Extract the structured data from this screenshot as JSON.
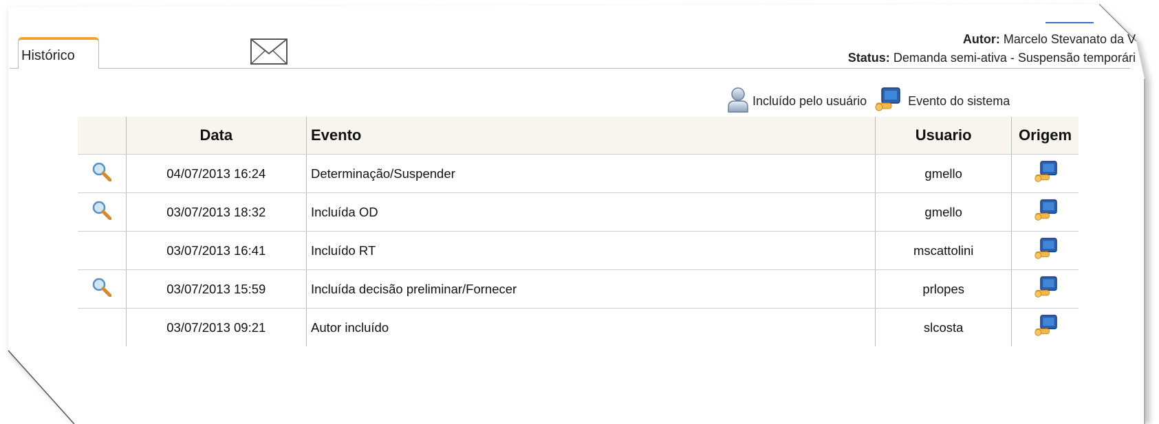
{
  "tab": {
    "label": "Histórico"
  },
  "header": {
    "autor_label": "Autor:",
    "autor_value": "Marcelo Stevanato da V",
    "status_label": "Status:",
    "status_value": "Demanda semi-ativa - Suspensão temporári"
  },
  "legend": {
    "user_label": "Incluído pelo usuário",
    "system_label": "Evento do sistema"
  },
  "table": {
    "headers": {
      "data": "Data",
      "evento": "Evento",
      "usuario": "Usuario",
      "origem": "Origem"
    },
    "rows": [
      {
        "data": "04/07/2013 16:24",
        "evento": "Determinação/Suspender",
        "usuario": "gmello"
      },
      {
        "data": "03/07/2013 18:32",
        "evento": "Incluída OD",
        "usuario": "gmello"
      },
      {
        "data": "03/07/2013 16:41",
        "evento": "Incluído RT",
        "usuario": "mscattolini"
      },
      {
        "data": "03/07/2013 15:59",
        "evento": "Incluída decisão preliminar/Fornecer",
        "usuario": "prlopes"
      },
      {
        "data": "03/07/2013 09:21",
        "evento": "Autor incluído",
        "usuario": "slcosta"
      }
    ]
  },
  "icons": {
    "magnifier": "magnifier-icon",
    "system": "system-event-icon",
    "user": "user-icon",
    "mail": "envelope-icon"
  },
  "colors": {
    "tab_accent": "#f0a332",
    "header_bg": "#f7f5ee"
  }
}
